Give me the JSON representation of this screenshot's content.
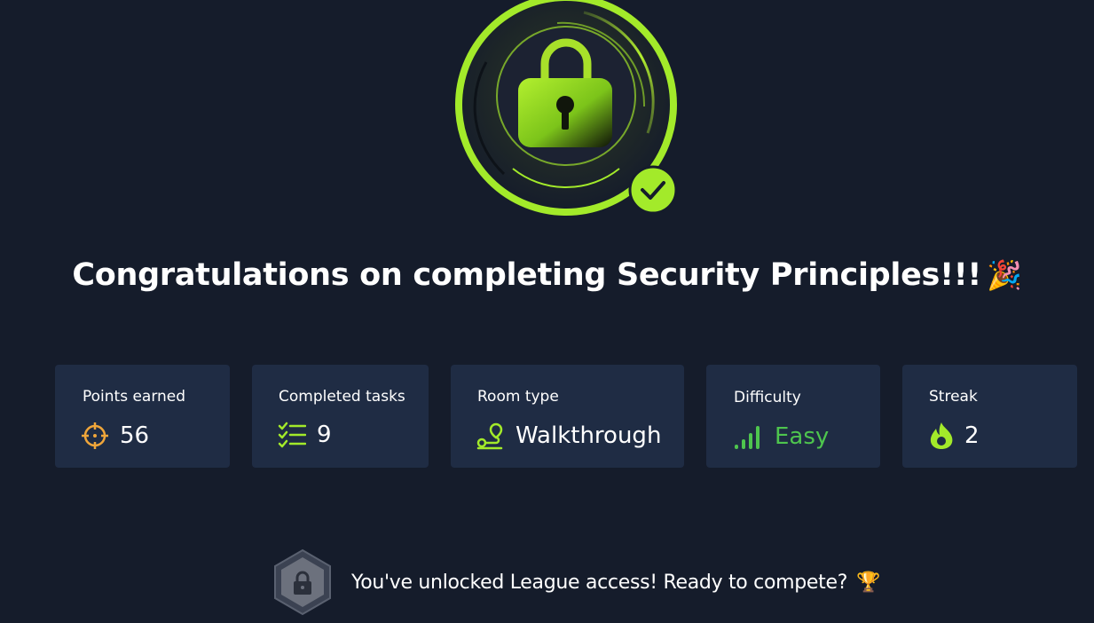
{
  "colors": {
    "background": "#151c2b",
    "card": "#1f2c44",
    "accent_green": "#a3ea2a",
    "easy_green": "#4ec54e",
    "points_orange": "#f0a63a"
  },
  "badge": {
    "icon": "lock-icon",
    "status_icon": "check-icon"
  },
  "title": {
    "text": "Congratulations on completing Security Principles!!!",
    "emoji": "🎉"
  },
  "stats": {
    "points": {
      "label": "Points earned",
      "value": "56",
      "icon": "crosshair-icon"
    },
    "tasks": {
      "label": "Completed tasks",
      "value": "9",
      "icon": "checklist-icon"
    },
    "room_type": {
      "label": "Room type",
      "value": "Walkthrough",
      "icon": "route-icon"
    },
    "difficulty": {
      "label": "Difficulty",
      "value": "Easy",
      "icon": "signal-bars-icon"
    },
    "streak": {
      "label": "Streak",
      "value": "2",
      "icon": "flame-icon"
    }
  },
  "league": {
    "text": "You've unlocked League access! Ready to compete?",
    "emoji": "🏆",
    "icon": "hexagon-lock-icon"
  }
}
